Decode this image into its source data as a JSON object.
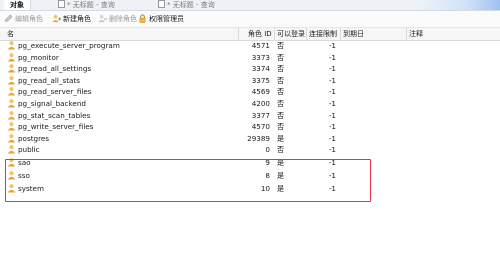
{
  "tabs": [
    {
      "label": "对象"
    },
    {
      "label": "* 无标题 - 查询"
    },
    {
      "label": "* 无标题 - 查询"
    }
  ],
  "toolbar": {
    "edit_role": "编辑角色",
    "new_role": "新建角色",
    "delete_role": "删除角色",
    "privilege_manager": "权限管理员"
  },
  "table": {
    "headers": {
      "name": "名",
      "role_id": "角色 ID",
      "can_login": "可以登录",
      "conn_limit": "连接限制",
      "expires": "到期日",
      "comment": "注释"
    },
    "rows": [
      {
        "name": "pg_execute_server_program",
        "role_id": "4571",
        "can_login": "否",
        "conn_limit": "-1"
      },
      {
        "name": "pg_monitor",
        "role_id": "3373",
        "can_login": "否",
        "conn_limit": "-1"
      },
      {
        "name": "pg_read_all_settings",
        "role_id": "3374",
        "can_login": "否",
        "conn_limit": "-1"
      },
      {
        "name": "pg_read_all_stats",
        "role_id": "3375",
        "can_login": "否",
        "conn_limit": "-1"
      },
      {
        "name": "pg_read_server_files",
        "role_id": "4569",
        "can_login": "否",
        "conn_limit": "-1"
      },
      {
        "name": "pg_signal_backend",
        "role_id": "4200",
        "can_login": "否",
        "conn_limit": "-1"
      },
      {
        "name": "pg_stat_scan_tables",
        "role_id": "3377",
        "can_login": "否",
        "conn_limit": "-1"
      },
      {
        "name": "pg_write_server_files",
        "role_id": "4570",
        "can_login": "否",
        "conn_limit": "-1"
      },
      {
        "name": "postgres",
        "role_id": "29389",
        "can_login": "是",
        "conn_limit": "-1"
      },
      {
        "name": "public",
        "role_id": "0",
        "can_login": "否",
        "conn_limit": "-1"
      },
      {
        "name": "sao",
        "role_id": "9",
        "can_login": "是",
        "conn_limit": "-1"
      },
      {
        "name": "sso",
        "role_id": "8",
        "can_login": "是",
        "conn_limit": "-1"
      },
      {
        "name": "system",
        "role_id": "10",
        "can_login": "是",
        "conn_limit": "-1"
      }
    ]
  },
  "colors": {
    "highlight": "#e2383f",
    "user_icon_body": "#e8a23b",
    "user_icon_head": "#f3c16a"
  },
  "icons": {
    "edit": "pencil-icon",
    "new": "add-user-icon",
    "delete": "remove-user-icon",
    "privilege": "lock-icon",
    "row": "user-icon"
  }
}
